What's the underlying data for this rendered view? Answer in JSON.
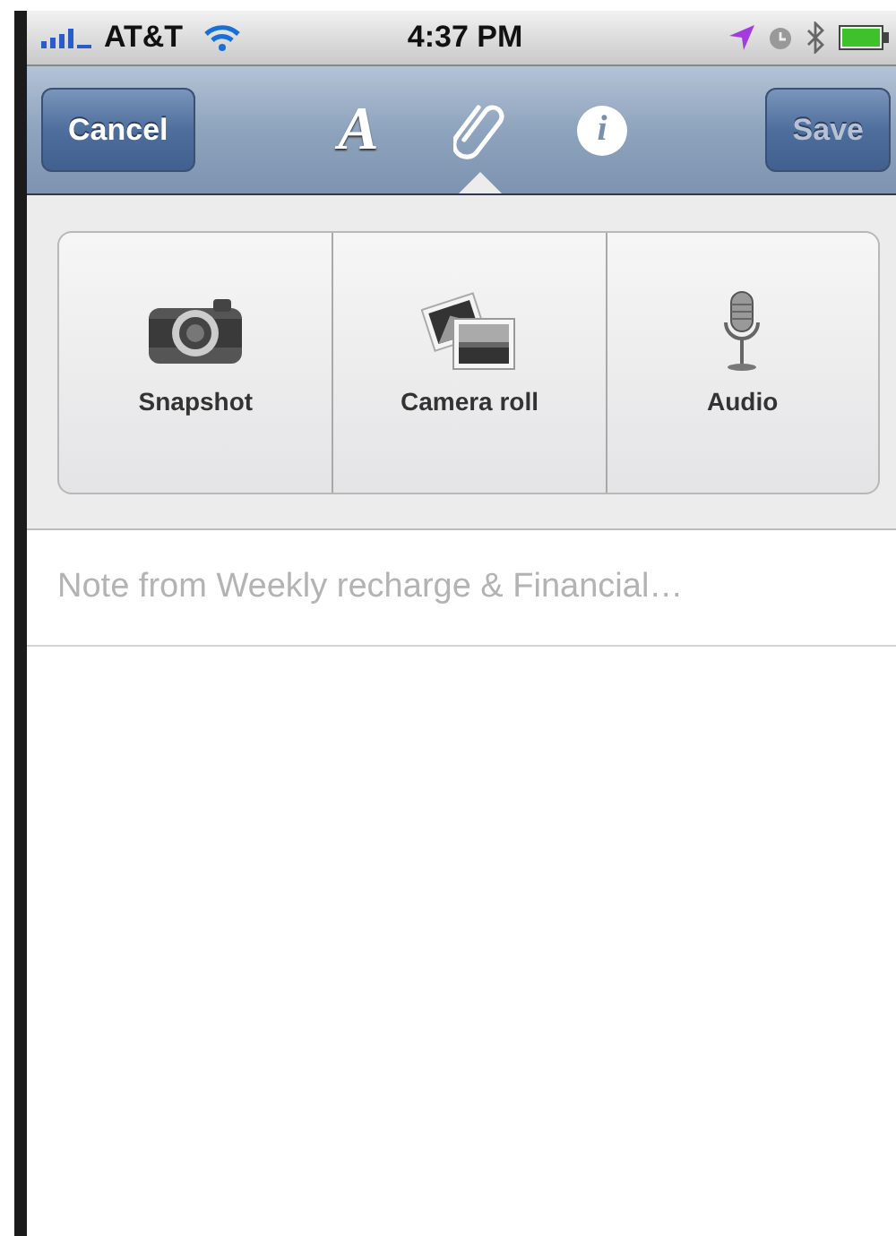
{
  "status_bar": {
    "carrier": "AT&T",
    "time": "4:37 PM"
  },
  "nav_bar": {
    "cancel": {
      "label": "Cancel",
      "disabled": false
    },
    "save": {
      "label": "Save",
      "disabled": true
    },
    "tabs": [
      {
        "kind": "text",
        "label": "A",
        "selected": false
      },
      {
        "kind": "attach",
        "selected": true
      },
      {
        "kind": "info",
        "label": "i",
        "selected": false
      }
    ]
  },
  "attach_options": [
    {
      "kind": "camera",
      "label": "Snapshot"
    },
    {
      "kind": "photos",
      "label": "Camera roll"
    },
    {
      "kind": "mic",
      "label": "Audio"
    }
  ],
  "note_title": {
    "placeholder": "Note from Weekly recharge & Financial…"
  }
}
